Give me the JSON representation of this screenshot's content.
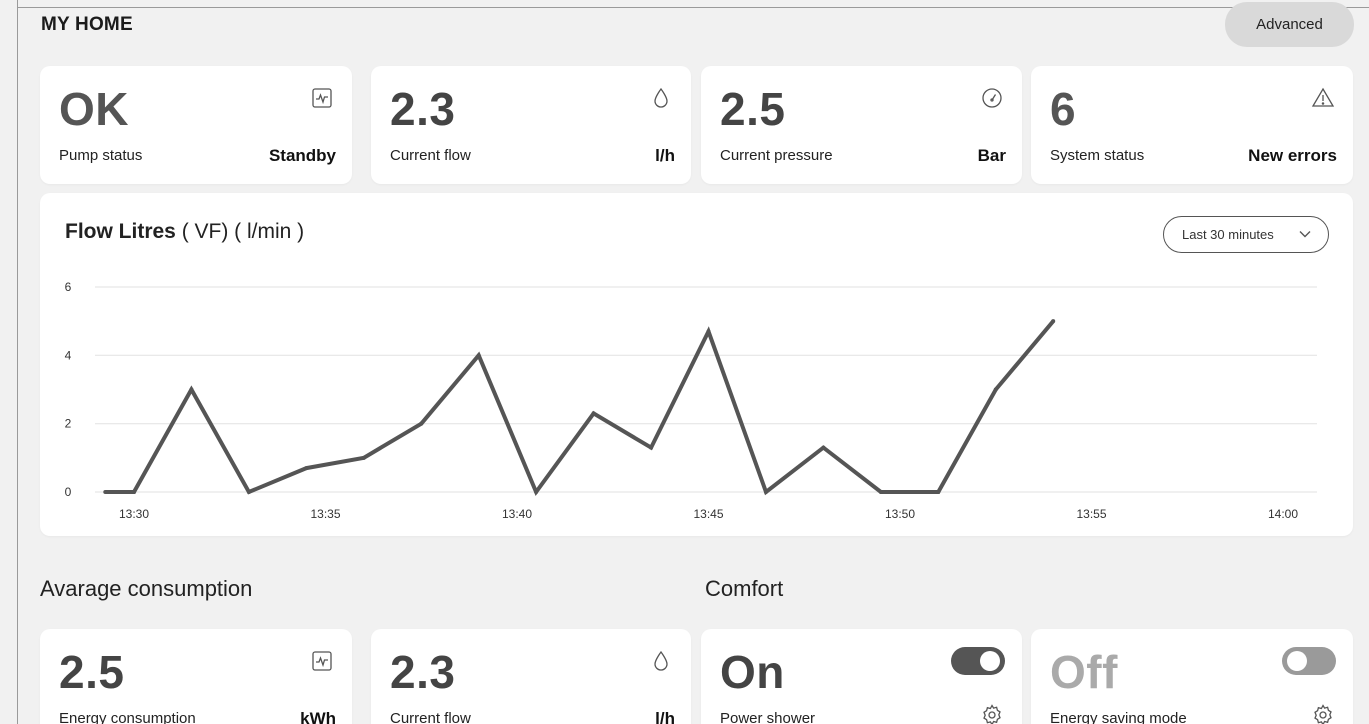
{
  "header": {
    "title": "MY HOME",
    "advanced_label": "Advanced"
  },
  "stats": [
    {
      "value": "OK",
      "label": "Pump status",
      "unit": "Standby",
      "icon": "activity-icon"
    },
    {
      "value": "2.3",
      "label": "Current flow",
      "unit": "l/h",
      "icon": "droplet-icon"
    },
    {
      "value": "2.5",
      "label": "Current pressure",
      "unit": "Bar",
      "icon": "gauge-icon"
    },
    {
      "value": "6",
      "label": "System status",
      "unit": "New errors",
      "icon": "warning-icon"
    }
  ],
  "chart": {
    "title_bold": "Flow Litres",
    "title_rest": " ( VF) ( l/min )",
    "range_label": "Last 30 minutes"
  },
  "chart_data": {
    "type": "line",
    "title": "Flow Litres ( VF) ( l/min )",
    "x_ticks": [
      "13:30",
      "13:35",
      "13:40",
      "13:45",
      "13:50",
      "13:55",
      "14:00"
    ],
    "y_ticks": [
      "0",
      "2",
      "4",
      "6"
    ],
    "ylim": [
      0,
      6
    ],
    "xlim_minutes": [
      13.5,
      14.0
    ],
    "grid": true,
    "series": [
      {
        "x": [
          "13:29:15",
          "13:30",
          "13:31:30",
          "13:33",
          "13:34:30",
          "13:36",
          "13:37:30",
          "13:39",
          "13:40:30",
          "13:42",
          "13:43:30",
          "13:45",
          "13:46:30",
          "13:48",
          "13:49:30",
          "13:51",
          "13:52:30",
          "13:54",
          "13:55:30",
          "13:57"
        ],
        "values": [
          0,
          0,
          3.0,
          0,
          0.7,
          1.0,
          2.0,
          4.0,
          0,
          2.3,
          1.3,
          4.7,
          0,
          1.3,
          0,
          0,
          3.0,
          5.0,
          null,
          null
        ],
        "points": [
          [
            "13:29:15",
            0
          ],
          [
            "13:30",
            0
          ],
          [
            "13:31:30",
            3.0
          ],
          [
            "13:33",
            0
          ],
          [
            "13:34:30",
            0.7
          ],
          [
            "13:36",
            1.0
          ],
          [
            "13:37:30",
            2.0
          ],
          [
            "13:39",
            4.0
          ],
          [
            "13:40:30",
            0
          ],
          [
            "13:42",
            2.3
          ],
          [
            "13:43:30",
            1.3
          ],
          [
            "13:45",
            4.7
          ],
          [
            "13:46:30",
            0
          ],
          [
            "13:48",
            1.3
          ],
          [
            "13:49:30",
            0
          ],
          [
            "13:51",
            0
          ],
          [
            "13:52:30",
            3.0
          ],
          [
            "13:54",
            5.0
          ]
        ]
      }
    ]
  },
  "sections": {
    "consumption_title": "Avarage consumption",
    "comfort_title": "Comfort"
  },
  "consumption": [
    {
      "value": "2.5",
      "label": "Energy consumption",
      "unit": "kWh",
      "icon": "activity-icon"
    },
    {
      "value": "2.3",
      "label": "Current flow",
      "unit": "l/h",
      "icon": "droplet-icon"
    }
  ],
  "comfort": [
    {
      "value": "On",
      "label": "Power shower",
      "toggle": "on",
      "icon": "gear-icon"
    },
    {
      "value": "Off",
      "label": "Energy saving mode",
      "toggle": "off",
      "icon": "gear-icon"
    }
  ]
}
